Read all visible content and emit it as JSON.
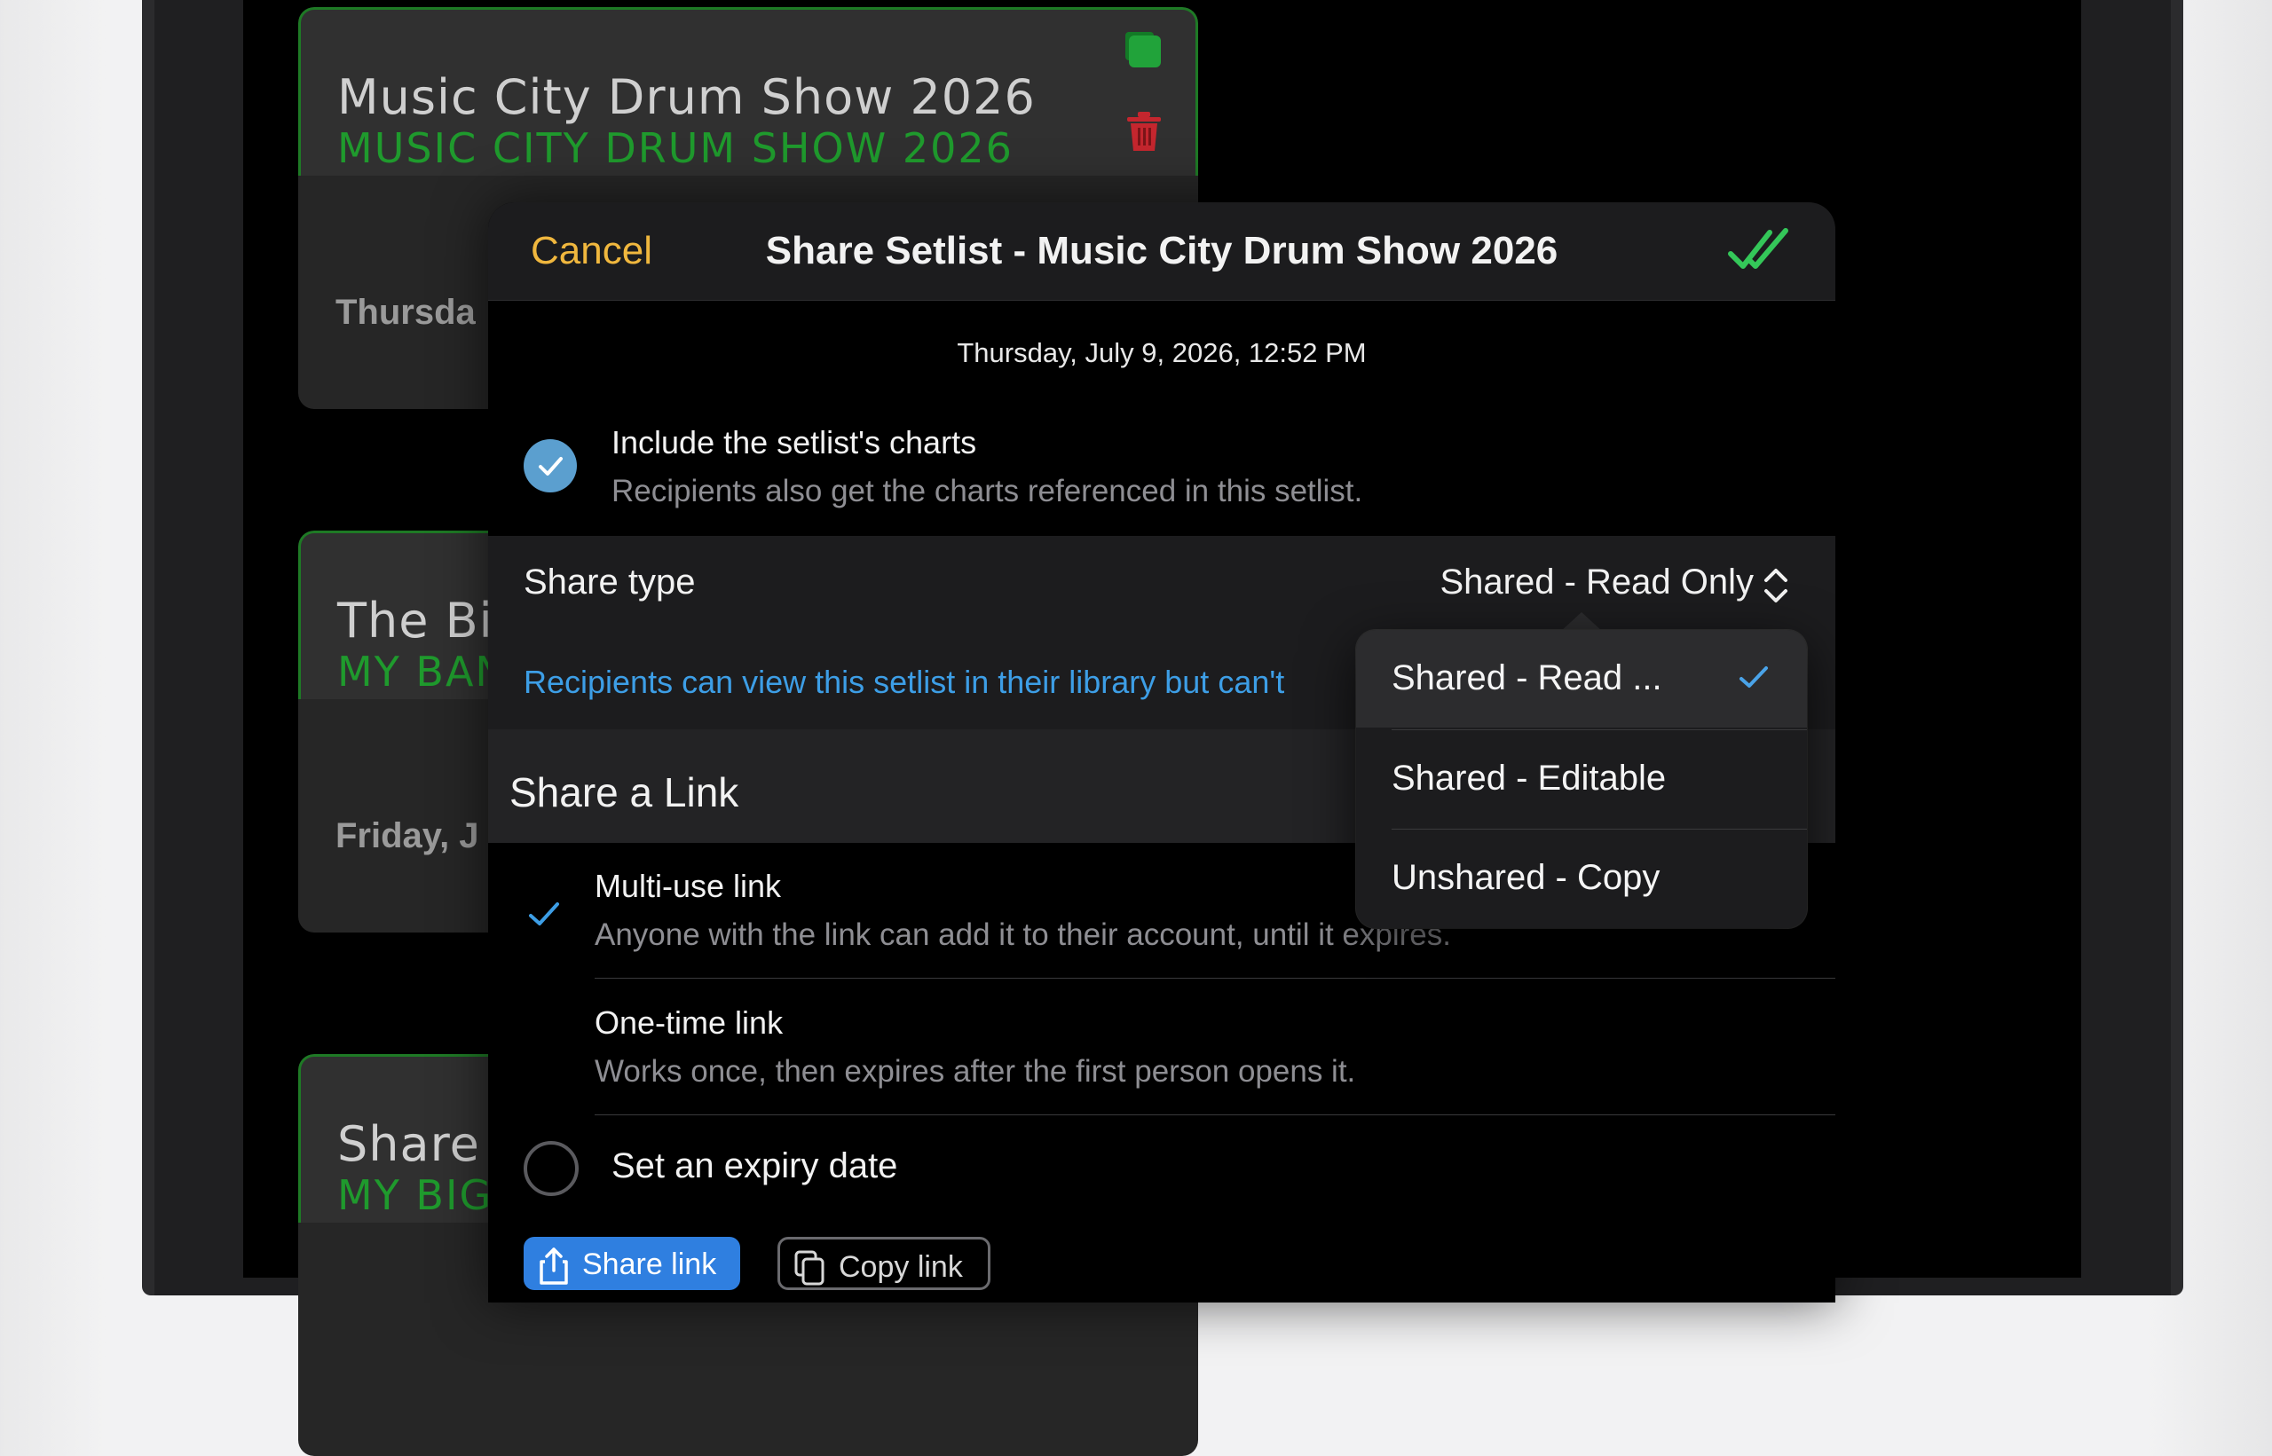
{
  "background_cards": [
    {
      "title": "Music City Drum Show 2026",
      "subtitle": "MUSIC CITY DRUM SHOW 2026",
      "date": "Thursda"
    },
    {
      "title": "The Bi",
      "subtitle": "MY BAN",
      "date": "Friday, J"
    },
    {
      "title": "Share t",
      "subtitle": "MY BIG"
    }
  ],
  "modal": {
    "cancel_label": "Cancel",
    "title": "Share Setlist - Music City Drum Show 2026",
    "timestamp": "Thursday, July 9, 2026, 12:52 PM",
    "include_charts": {
      "title": "Include the setlist's charts",
      "subtitle": "Recipients also get the charts referenced in this setlist.",
      "checked": true
    },
    "share_type": {
      "label": "Share type",
      "value": "Shared - Read Only",
      "description": "Recipients can view this setlist in their library but can't"
    },
    "share_link_section": {
      "title": "Share a Link",
      "options": [
        {
          "title": "Multi-use link",
          "subtitle": "Anyone with the link can add it to their account, until it expires.",
          "selected": true
        },
        {
          "title": "One-time link",
          "subtitle": "Works once, then expires after the first person opens it.",
          "selected": false
        }
      ],
      "expiry_label": "Set an expiry date",
      "share_link_button": "Share link",
      "copy_link_button": "Copy link"
    }
  },
  "share_type_menu": {
    "options": [
      {
        "label": "Shared - Read ...",
        "selected": true
      },
      {
        "label": "Shared - Editable",
        "selected": false
      },
      {
        "label": "Unshared - Copy",
        "selected": false
      }
    ]
  },
  "colors": {
    "accent_yellow": "#f0b73e",
    "accent_green": "#34c759",
    "accent_blue": "#3d9ee6",
    "trash_red": "#c4262e"
  }
}
